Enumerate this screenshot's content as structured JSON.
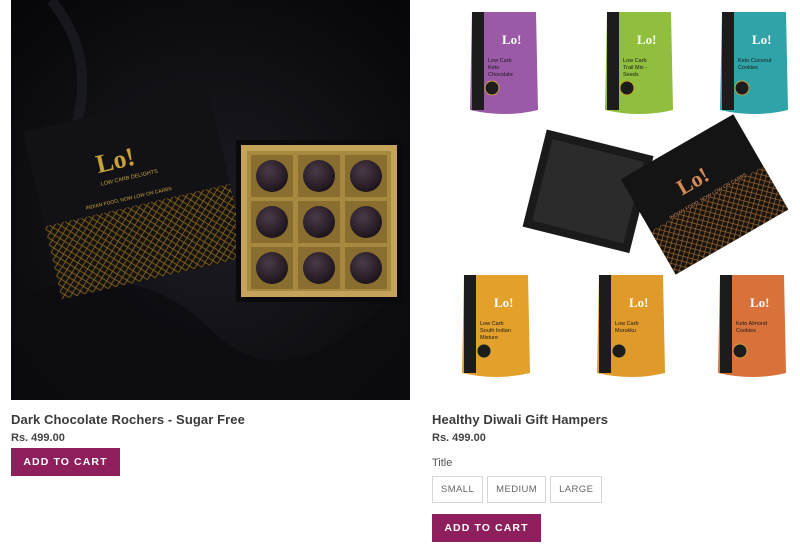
{
  "products": [
    {
      "title": "Dark Chocolate Rochers - Sugar Free",
      "price": "Rs. 499.00",
      "add_to_cart": "ADD TO CART",
      "box_brand": "Lo!",
      "box_sub": "LOW CARB DELIGHTS",
      "box_tagline": "INDIAN FOOD, NOW LOW ON CARBS"
    },
    {
      "title": "Healthy Diwali Gift Hampers",
      "price": "Rs. 499.00",
      "option_label": "Title",
      "options": [
        "SMALL",
        "MEDIUM",
        "LARGE"
      ],
      "add_to_cart": "ADD TO CART",
      "box_brand": "Lo!",
      "box_tagline": "INDIAN FOOD, NOW LOW ON CARBS",
      "pouches": [
        {
          "brand": "Lo!",
          "name": "Low Carb Keto Chocolate",
          "color": "#9a5aa6"
        },
        {
          "brand": "Lo!",
          "name": "Low Carb Trail Mix - Seeds",
          "color": "#8fbf3c"
        },
        {
          "brand": "Lo!",
          "name": "Keto Coconut Cookies",
          "color": "#2fa3a7"
        },
        {
          "brand": "Lo!",
          "name": "Low Carb South Indian Mixture",
          "color": "#e3a02a"
        },
        {
          "brand": "Lo!",
          "name": "Low Carb Murukku",
          "color": "#e09a2a"
        },
        {
          "brand": "Lo!",
          "name": "Keto Almond Cookies",
          "color": "#d9713a"
        }
      ]
    }
  ],
  "colors": {
    "accent": "#8e1f5c",
    "gold": "#c9a13b"
  }
}
